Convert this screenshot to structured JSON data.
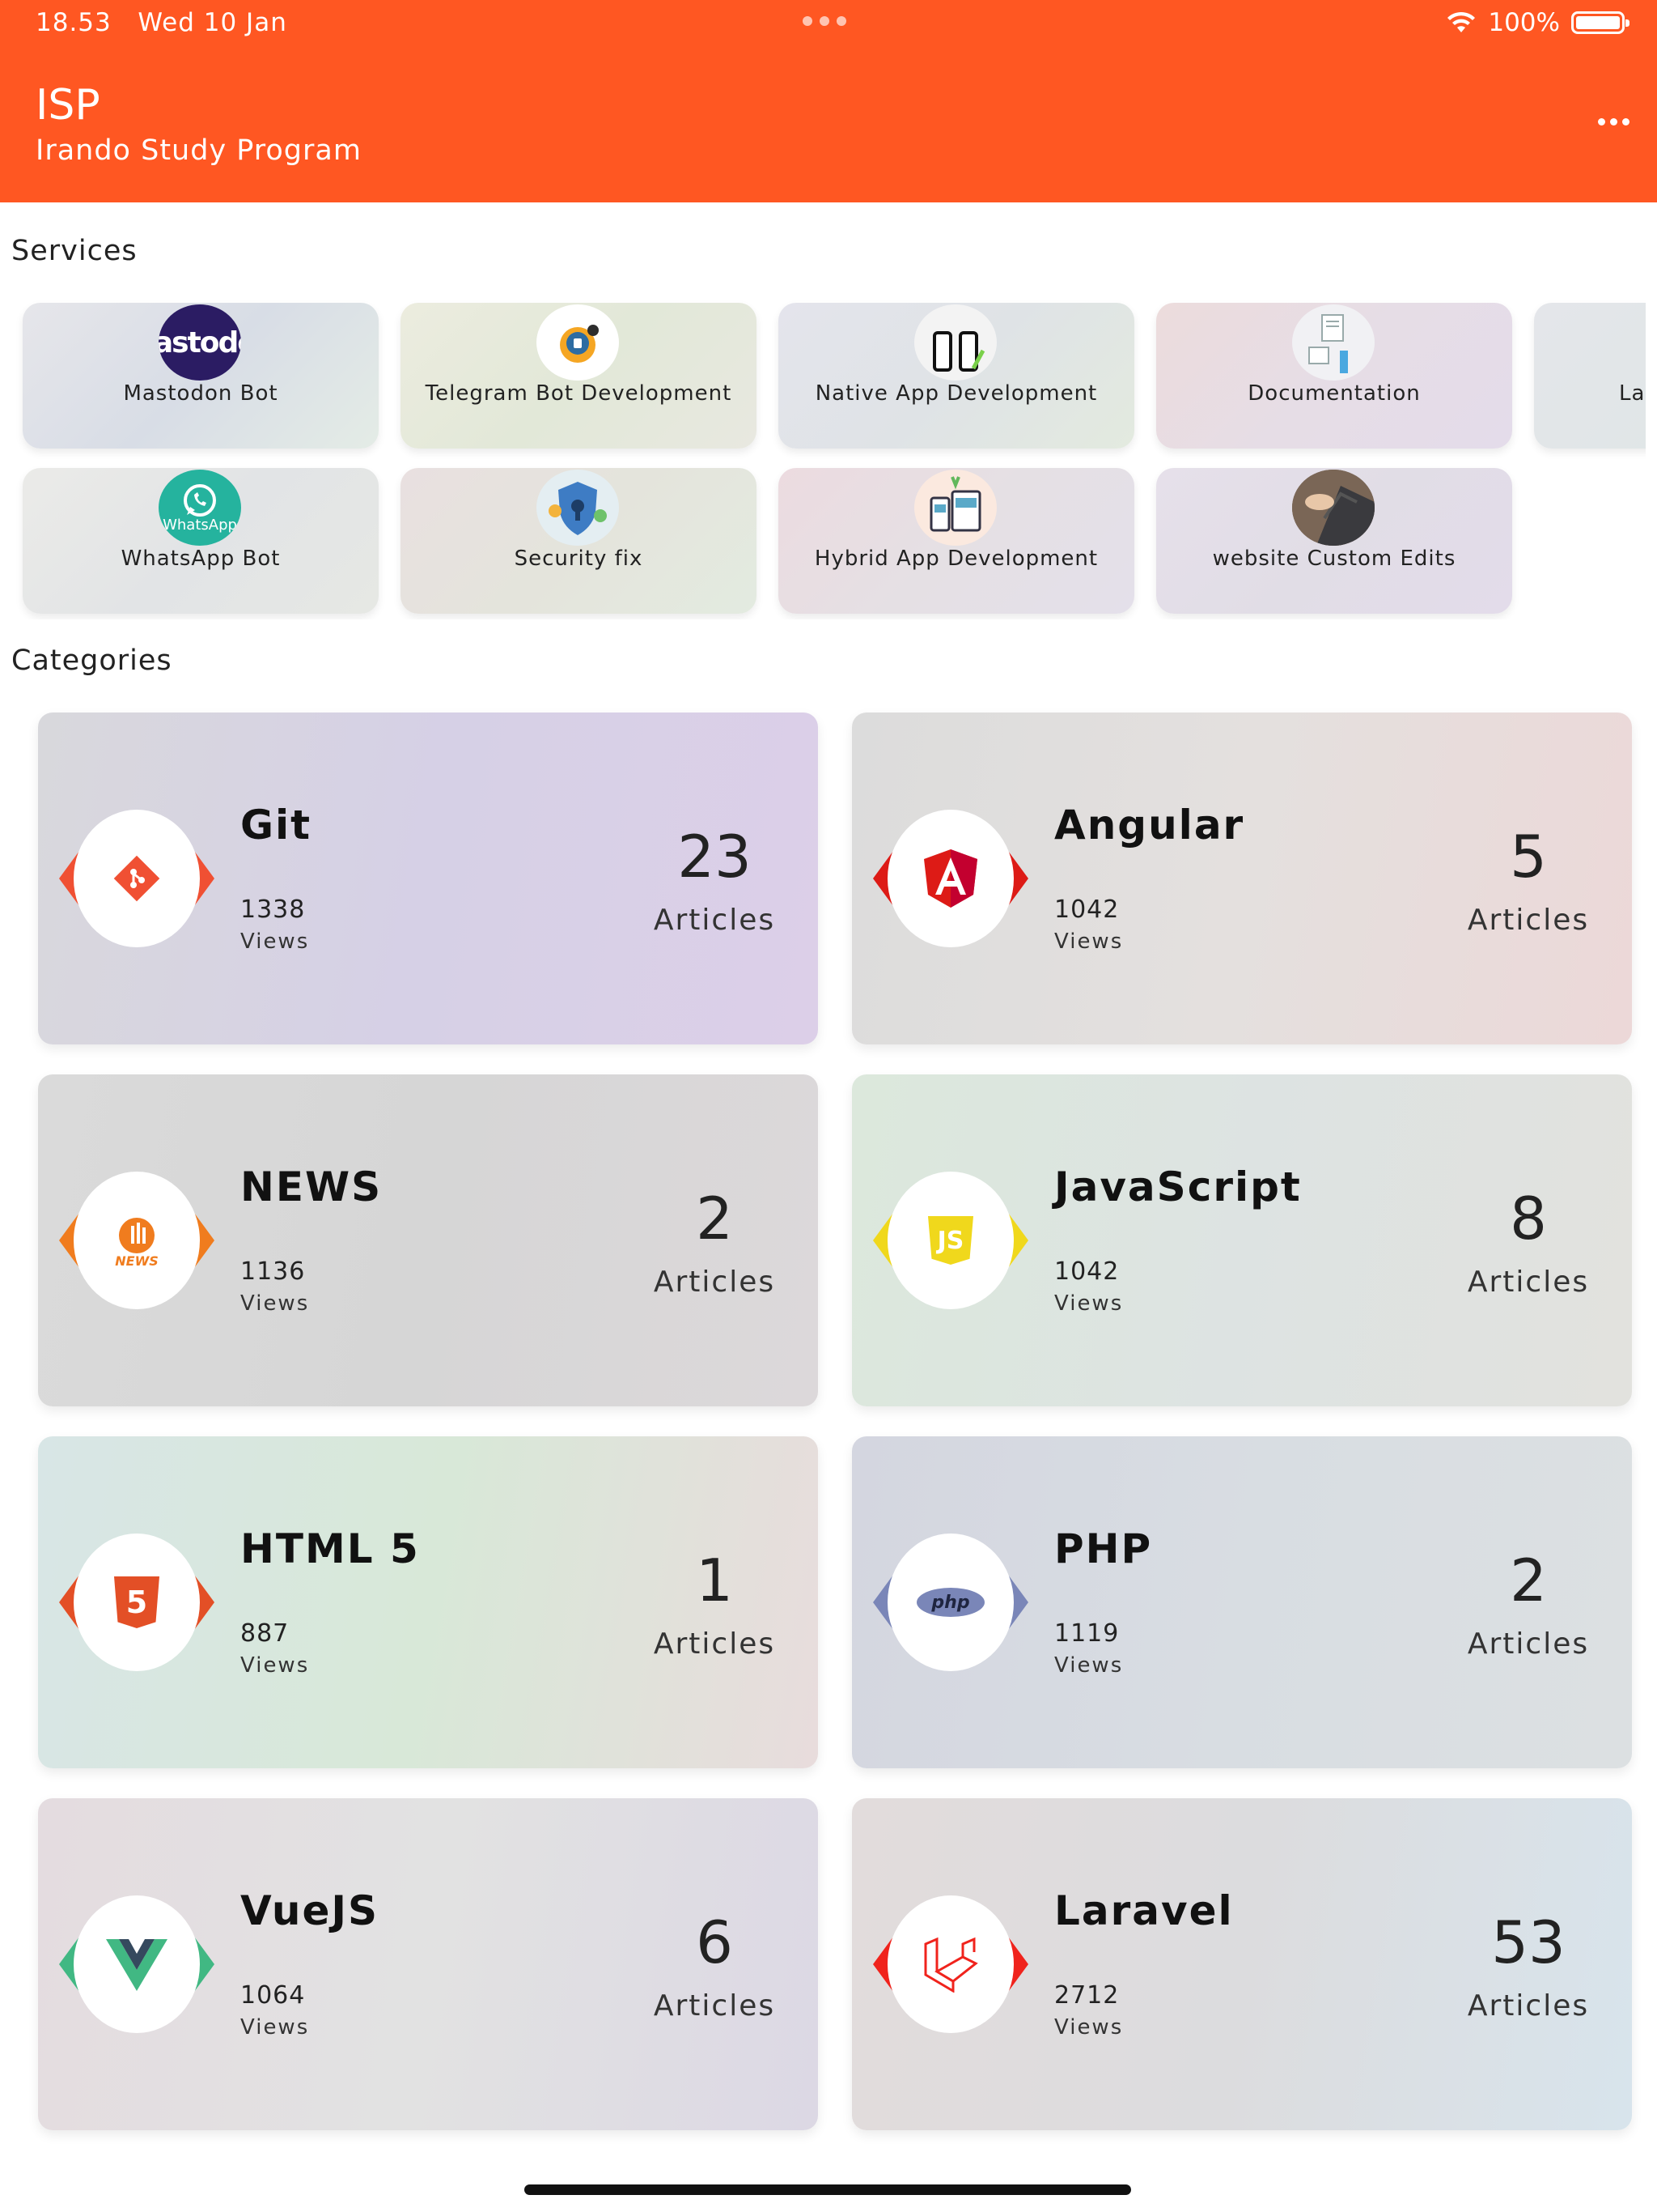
{
  "status_bar": {
    "time": "18.53",
    "date": "Wed 10 Jan",
    "battery": "100%"
  },
  "header": {
    "title": "ISP",
    "subtitle": "Irando Study Program",
    "accent_color": "#ff5722"
  },
  "services": {
    "title": "Services",
    "items": [
      {
        "label": "Mastodon Bot",
        "icon": "mastodon-logo-icon",
        "icon_text": "mastodon"
      },
      {
        "label": "Telegram Bot Development",
        "icon": "telegram-bot-icon"
      },
      {
        "label": "Native App Development",
        "icon": "phones-icon"
      },
      {
        "label": "Documentation",
        "icon": "documentation-icon"
      },
      {
        "label": "Lara",
        "icon": "laravel-icon"
      },
      {
        "label": "WhatsApp Bot",
        "icon": "whatsapp-icon",
        "icon_text": "WhatsApp"
      },
      {
        "label": "Security fix",
        "icon": "security-shield-icon"
      },
      {
        "label": "Hybrid App Development",
        "icon": "hybrid-app-icon"
      },
      {
        "label": "website Custom Edits",
        "icon": "laptop-typing-icon"
      }
    ]
  },
  "categories": {
    "title": "Categories",
    "items": [
      {
        "name": "Git",
        "views": "1338",
        "views_label": "Views",
        "count": "23",
        "count_label": "Articles",
        "icon": "git-icon",
        "color": "#f05033"
      },
      {
        "name": "Angular",
        "views": "1042",
        "views_label": "Views",
        "count": "5",
        "count_label": "Articles",
        "icon": "angular-icon",
        "color": "#dd1b16"
      },
      {
        "name": "NEWS",
        "views": "1136",
        "views_label": "Views",
        "count": "2",
        "count_label": "Articles",
        "icon": "news-icon",
        "icon_text": "NEWS",
        "color": "#f07c1e"
      },
      {
        "name": "JavaScript",
        "views": "1042",
        "views_label": "Views",
        "count": "8",
        "count_label": "Articles",
        "icon": "javascript-icon",
        "icon_text": "JS",
        "color": "#f0d81c"
      },
      {
        "name": "HTML 5",
        "views": "887",
        "views_label": "Views",
        "count": "1",
        "count_label": "Articles",
        "icon": "html5-icon",
        "icon_text": "5",
        "color": "#e34f26"
      },
      {
        "name": "PHP",
        "views": "1119",
        "views_label": "Views",
        "count": "2",
        "count_label": "Articles",
        "icon": "php-icon",
        "icon_text": "php",
        "color": "#7a86b8"
      },
      {
        "name": "VueJS",
        "views": "1064",
        "views_label": "Views",
        "count": "6",
        "count_label": "Articles",
        "icon": "vuejs-icon",
        "color": "#41b883"
      },
      {
        "name": "Laravel",
        "views": "2712",
        "views_label": "Views",
        "count": "53",
        "count_label": "Articles",
        "icon": "laravel-icon",
        "color": "#f0231c"
      }
    ]
  }
}
